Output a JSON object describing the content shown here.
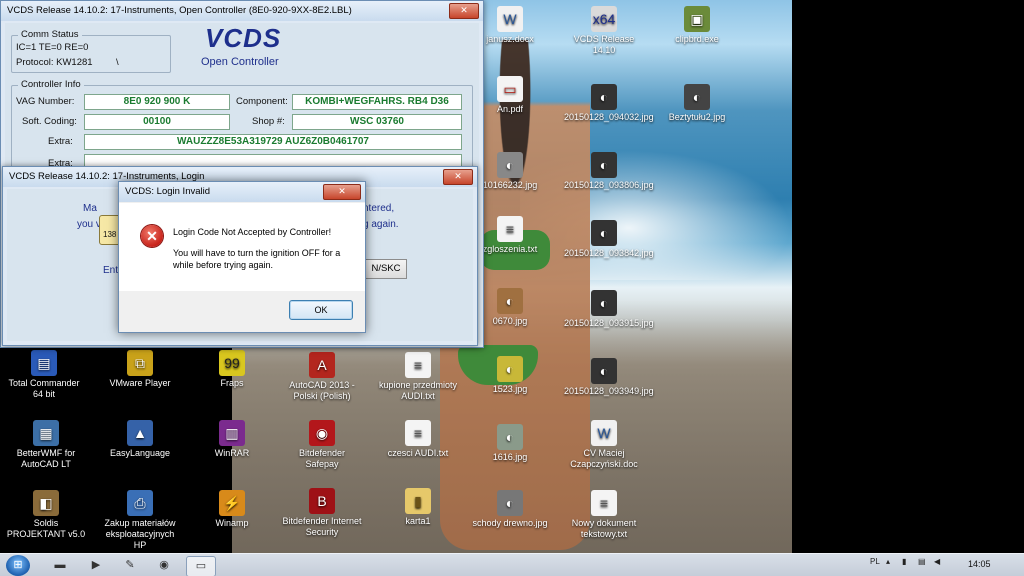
{
  "desktop": {
    "icons_left": [
      {
        "label": "Total Commander 64 bit",
        "icon": "floppy-icon",
        "color": "#2a5ab8"
      },
      {
        "label": "VMware Player",
        "icon": "vmware-icon",
        "color": "#c9a21a"
      },
      {
        "label": "Fraps",
        "icon": "fraps-icon",
        "color": "#d9c71f"
      },
      {
        "label": "BetterWMF for AutoCAD LT",
        "icon": "wmf-icon",
        "color": "#3c6fa6"
      },
      {
        "label": "EasyLanguage",
        "icon": "graduation-cap-icon",
        "color": "#3562a8"
      },
      {
        "label": "WinRAR",
        "icon": "winrar-icon",
        "color": "#7b2b8e"
      },
      {
        "label": "Soldis PROJEKTANT v5.0",
        "icon": "soldis-icon",
        "color": "#8a6b3a"
      },
      {
        "label": "Zakup materiałów eksploatacyjnych HP",
        "icon": "printer-icon",
        "color": "#3a6fb6"
      },
      {
        "label": "Winamp",
        "icon": "winamp-icon",
        "color": "#d88a1a"
      }
    ],
    "icons_middle": [
      {
        "label": "AutoCAD 2013 - Polski (Polish)",
        "icon": "autocad-icon",
        "color": "#b3261e"
      },
      {
        "label": "kupione przedmioty AUDI.txt",
        "icon": "text-file-icon",
        "color": "#f4f4f4"
      },
      {
        "label": "Bitdefender Safepay",
        "icon": "bitdefender-safepay-icon",
        "color": "#b3171b"
      },
      {
        "label": "czesci AUDI.txt",
        "icon": "text-file-icon",
        "color": "#f4f4f4"
      },
      {
        "label": "Bitdefender Internet Security",
        "icon": "bitdefender-icon",
        "color": "#9e1116"
      },
      {
        "label": "karta1",
        "icon": "folder-icon",
        "color": "#e6c86a"
      }
    ],
    "icons_beach": [
      {
        "label": "janusz.docx",
        "icon": "word-doc-icon",
        "color": "#f1f1f1"
      },
      {
        "label": "VCDS Release 14.10",
        "icon": "vcds-icon",
        "color": "#dadada"
      },
      {
        "label": "clipbrd.exe",
        "icon": "clipboard-icon",
        "color": "#6b8b3a"
      },
      {
        "label": "An.pdf",
        "icon": "pdf-icon",
        "color": "#f4f4f4"
      },
      {
        "label": "20150128_094032.jpg",
        "icon": "image-icon",
        "color": "#333333"
      },
      {
        "label": "Beztytułu2.jpg",
        "icon": "image-icon",
        "color": "#444444"
      },
      {
        "label": "10166232.jpg",
        "icon": "image-icon",
        "color": "#888888"
      },
      {
        "label": "20150128_093806.jpg",
        "icon": "image-icon",
        "color": "#333333"
      },
      {
        "label": "zgloszenia.txt",
        "icon": "text-file-icon",
        "color": "#f4f4f4"
      },
      {
        "label": "20150128_093842.jpg",
        "icon": "image-icon",
        "color": "#333333"
      },
      {
        "label": "0670.jpg",
        "icon": "image-icon",
        "color": "#a07040"
      },
      {
        "label": "20150128_093915.jpg",
        "icon": "image-icon",
        "color": "#333333"
      },
      {
        "label": "1523.jpg",
        "icon": "image-icon",
        "color": "#c8b838"
      },
      {
        "label": "20150128_093949.jpg",
        "icon": "image-icon",
        "color": "#333333"
      },
      {
        "label": "1616.jpg",
        "icon": "image-icon",
        "color": "#8a9a8a"
      },
      {
        "label": "CV Maciej Czapczyński.doc",
        "icon": "word-doc-icon",
        "color": "#f1f1f1"
      },
      {
        "label": "schody drewno.jpg",
        "icon": "image-icon",
        "color": "#777777"
      },
      {
        "label": "Nowy dokument tekstowy.txt",
        "icon": "text-file-icon",
        "color": "#f4f4f4"
      }
    ]
  },
  "main_window": {
    "title": "VCDS Release 14.10.2: 17-Instruments,  Open Controller (8E0-920-9XX-8E2.LBL)",
    "comm_status": {
      "title": "Comm Status",
      "line1": "IC=1  TE=0  RE=0",
      "line2": "Protocol: KW1281",
      "tick": "\\"
    },
    "logo": "VCDS",
    "subtitle": "Open Controller",
    "controller_info": {
      "title": "Controller Info",
      "vag_label": "VAG Number:",
      "vag_value": "8E0 920 900 K",
      "component_label": "Component:",
      "component_value": "KOMBI+WEGFAHRS. RB4 D36",
      "coding_label": "Soft. Coding:",
      "coding_value": "00100",
      "shop_label": "Shop #:",
      "shop_value": "WSC 03760",
      "extra_label": "Extra:",
      "extra_value": "WAUZZZ8E53A319729     AUZ6Z0B0461707",
      "extra2_label": "Extra:",
      "extra2_value": ""
    }
  },
  "login_window": {
    "title": "VCDS Release 14.10.2: 17-Instruments,  Login",
    "frag_left1": "Ma",
    "frag_left2": "you v",
    "frag_right1": "ntered,",
    "frag_right2": "g again.",
    "frag_enter": "Ente",
    "frag_num": "138",
    "frag_btn": "N/SKC"
  },
  "dialog": {
    "title": "VCDS: Login Invalid",
    "message": "Login Code Not Accepted by Controller!",
    "detail": "You will have to turn the ignition OFF for a while before trying again.",
    "ok": "OK"
  },
  "taskbar": {
    "lang": "PL",
    "time": "14:05"
  }
}
